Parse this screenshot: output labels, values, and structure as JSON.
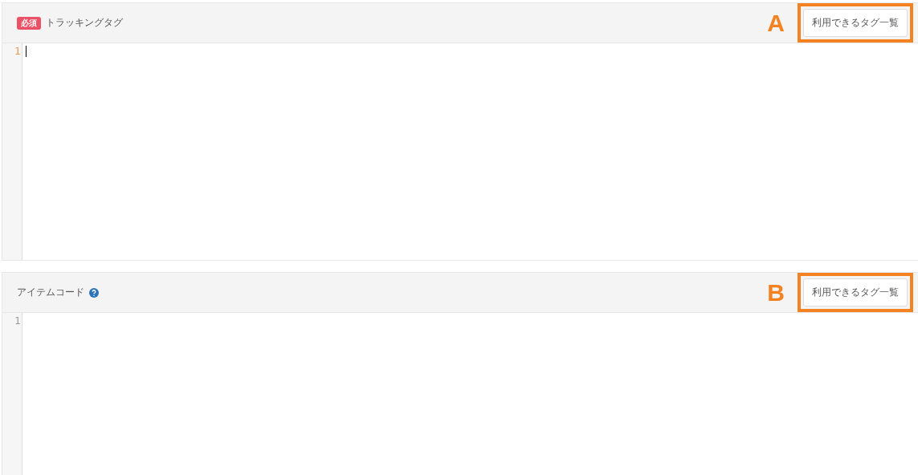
{
  "fields": [
    {
      "label": "トラッキングタグ",
      "badge": "必須",
      "help": false,
      "annotation": "A",
      "button": "利用できるタグ一覧",
      "line_numbers": [
        "1"
      ],
      "focused": true
    },
    {
      "label": "アイテムコード",
      "help": true,
      "annotation": "B",
      "button": "利用できるタグ一覧",
      "line_numbers": [
        "1"
      ],
      "focused": false
    }
  ]
}
